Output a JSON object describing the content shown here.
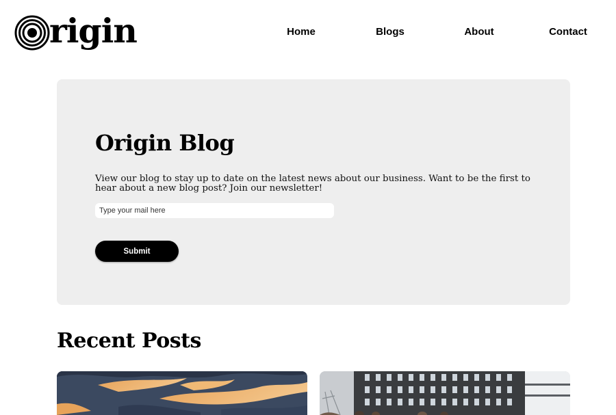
{
  "logo": {
    "text": "rigin"
  },
  "nav": {
    "home": "Home",
    "blogs": "Blogs",
    "about": "About",
    "contact": "Contact"
  },
  "hero": {
    "title": "Origin Blog",
    "description": "View our blog to stay up to date on the latest news about our business. Want to be the first to hear about a new blog post? Join our newsletter!",
    "email_placeholder": "Type your mail here",
    "submit_label": "Submit"
  },
  "recent": {
    "title": "Recent Posts"
  },
  "colors": {
    "hero_bg": "#eeeeee",
    "button_bg": "#000000",
    "text": "#000000"
  }
}
